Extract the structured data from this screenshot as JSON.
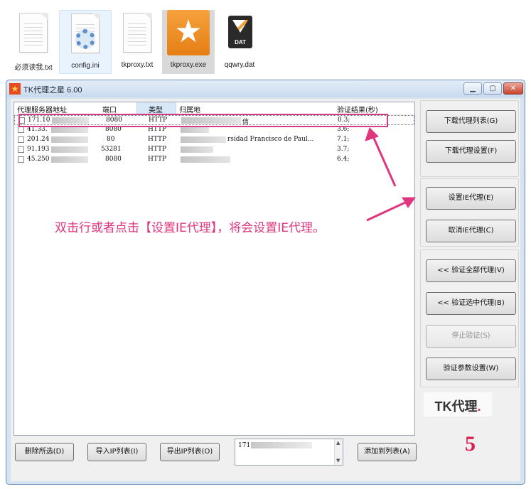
{
  "explorer": {
    "files": [
      {
        "name": "必须读我.txt",
        "icon": "text-file-icon"
      },
      {
        "name": "config.ini",
        "icon": "settings-file-icon"
      },
      {
        "name": "tkproxy.txt",
        "icon": "text-file-icon"
      },
      {
        "name": "tkproxy.exe",
        "icon": "star-app-icon"
      },
      {
        "name": "qqwry.dat",
        "icon": "dat-file-icon",
        "icon_label": "DAT"
      }
    ]
  },
  "window": {
    "title": "TK代理之星 6.00",
    "icon": "star-app-icon",
    "controls": {
      "minimize": "minimize-icon",
      "maximize": "maximize-icon",
      "close": "close-icon"
    }
  },
  "proxy_list": {
    "columns": [
      "代理服务器地址",
      "端口",
      "类型",
      "归属地",
      "验证结果(秒)"
    ],
    "sorted_column": "类型",
    "rows": [
      {
        "address": "171.10",
        "port": "8080",
        "type": "HTTP",
        "location": "信",
        "result": "0.3;",
        "checked": false
      },
      {
        "address": "41.33.",
        "port": "8080",
        "type": "HTTP",
        "location": "",
        "result": "3.6;",
        "checked": false
      },
      {
        "address": "201.24",
        "port": "80",
        "type": "HTTP",
        "location": "rsidad Francisco de Paul...",
        "result": "7.1;",
        "checked": false
      },
      {
        "address": "91.193",
        "port": "53281",
        "type": "HTTP",
        "location": "",
        "result": "3.7;",
        "checked": false
      },
      {
        "address": "45.250",
        "port": "8080",
        "type": "HTTP",
        "location": "",
        "result": "6.4;",
        "checked": false
      }
    ]
  },
  "bottom": {
    "delete_selected": "删除所选(D)",
    "import_ip": "导入IP列表(I)",
    "export_ip": "导出IP列表(O)",
    "ip_input_value": "171",
    "add_to_list": "添加到列表(A)"
  },
  "right_panel": {
    "download_list": "下载代理列表(G)",
    "download_settings": "下载代理设置(F)",
    "set_ie_proxy": "设置IE代理(E)",
    "cancel_ie_proxy": "取消IE代理(C)",
    "verify_all": "<< 验证全部代理(V)",
    "verify_selected": "<< 验证选中代理(B)",
    "stop_verify": "停止验证(S)",
    "verify_params": "验证参数设置(W)"
  },
  "branding": {
    "logo_text": "TK代理",
    "logo_dot": ".",
    "step_number": "5"
  },
  "annotation": {
    "text": "双击行或者点击【设置IE代理】，将会设置IE代理。",
    "color": "#e0357f"
  }
}
